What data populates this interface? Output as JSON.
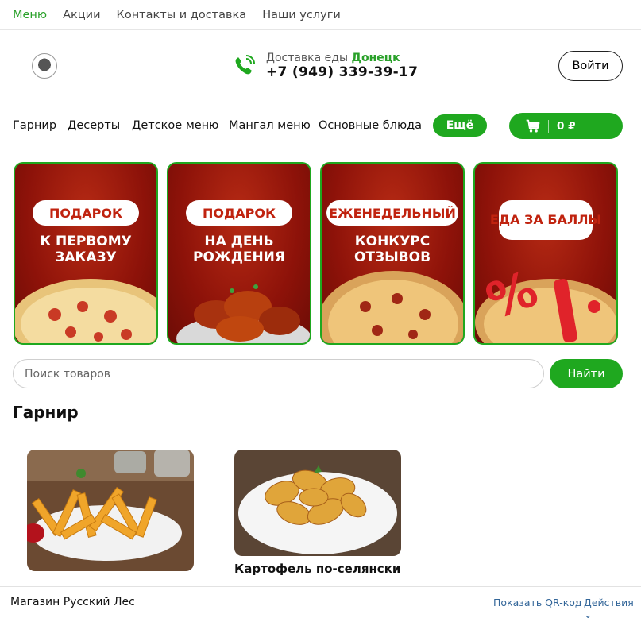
{
  "top_nav": {
    "items": [
      "Меню",
      "Акции",
      "Контакты и доставка",
      "Наши услуги"
    ]
  },
  "header": {
    "delivery_label": "Доставка еды",
    "city": "Донецк",
    "phone": "+7 (949) 339-39-17",
    "login_label": "Войти",
    "icons": {
      "logo": "restaurant-logo",
      "phone": "phone-icon"
    }
  },
  "categories": {
    "items": [
      "Гарнир",
      "Десерты",
      "Детское меню",
      "Мангал меню",
      "Основные блюда"
    ],
    "more_label": "Ещё",
    "cart_amount": "0 ₽",
    "cart_icon": "cart-icon"
  },
  "promos": [
    {
      "pill": "ПОДАРОК",
      "sub": "К ПЕРВОМУ ЗАКАЗУ"
    },
    {
      "pill": "ПОДАРОК",
      "sub": "НА ДЕНЬ РОЖДЕНИЯ"
    },
    {
      "pill": "ЕЖЕНЕДЕЛЬНЫЙ",
      "sub": "КОНКУРС ОТЗЫВОВ"
    },
    {
      "pill": "ЕДА ЗА БАЛЛЫ",
      "sub": ""
    }
  ],
  "search": {
    "placeholder": "Поиск товаров",
    "button_label": "Найти"
  },
  "section": {
    "title": "Гарнир",
    "products": [
      {
        "name": ""
      },
      {
        "name": "Картофель по-селянски"
      }
    ]
  },
  "footer": {
    "shop_name": "Магазин Русский Лес",
    "qr_label": "Показать QR-код",
    "separator": "·",
    "actions_label": "Действия ⌄"
  },
  "colors": {
    "accent": "#1fa81f",
    "promo_bg": "#8d1209",
    "link": "#336699"
  }
}
